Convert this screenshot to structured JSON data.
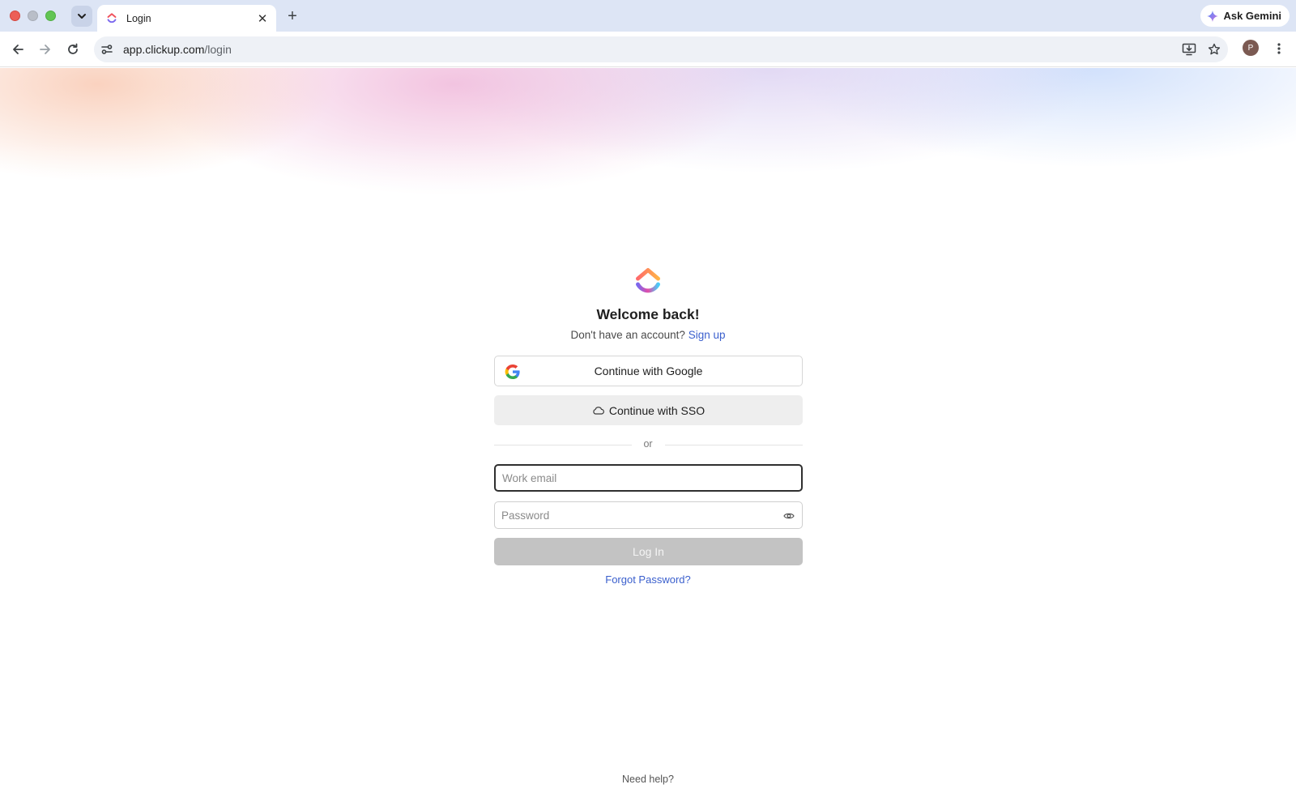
{
  "browser": {
    "tab": {
      "title": "Login",
      "close_glyph": "✕"
    },
    "new_tab_glyph": "+",
    "gemini_label": "Ask Gemini",
    "url_host": "app.clickup.com",
    "url_path": "/login",
    "profile_initial": "P",
    "icons": [
      "tab-menu-chevron-icon",
      "favicon-icon",
      "back-arrow-icon",
      "forward-arrow-icon",
      "reload-icon",
      "site-info-icon",
      "install-app-icon",
      "bookmark-star-icon",
      "kebab-menu-icon",
      "gemini-sparkle-icon"
    ]
  },
  "login": {
    "heading": "Welcome back!",
    "no_account_text": "Don't have an account?",
    "signup_link": "Sign up",
    "google_button": "Continue with Google",
    "sso_button": "Continue with SSO",
    "divider_text": "or",
    "email_placeholder": "Work email",
    "email_value": "",
    "password_placeholder": "Password",
    "password_value": "",
    "login_button": "Log In",
    "forgot_password": "Forgot Password?",
    "help_text": "Need help?"
  },
  "colors": {
    "link": "#3a5fcd",
    "login_disabled_bg": "#c3c3c3",
    "sso_bg": "#eeeeee",
    "chrome_tabbar": "#dde5f5"
  }
}
